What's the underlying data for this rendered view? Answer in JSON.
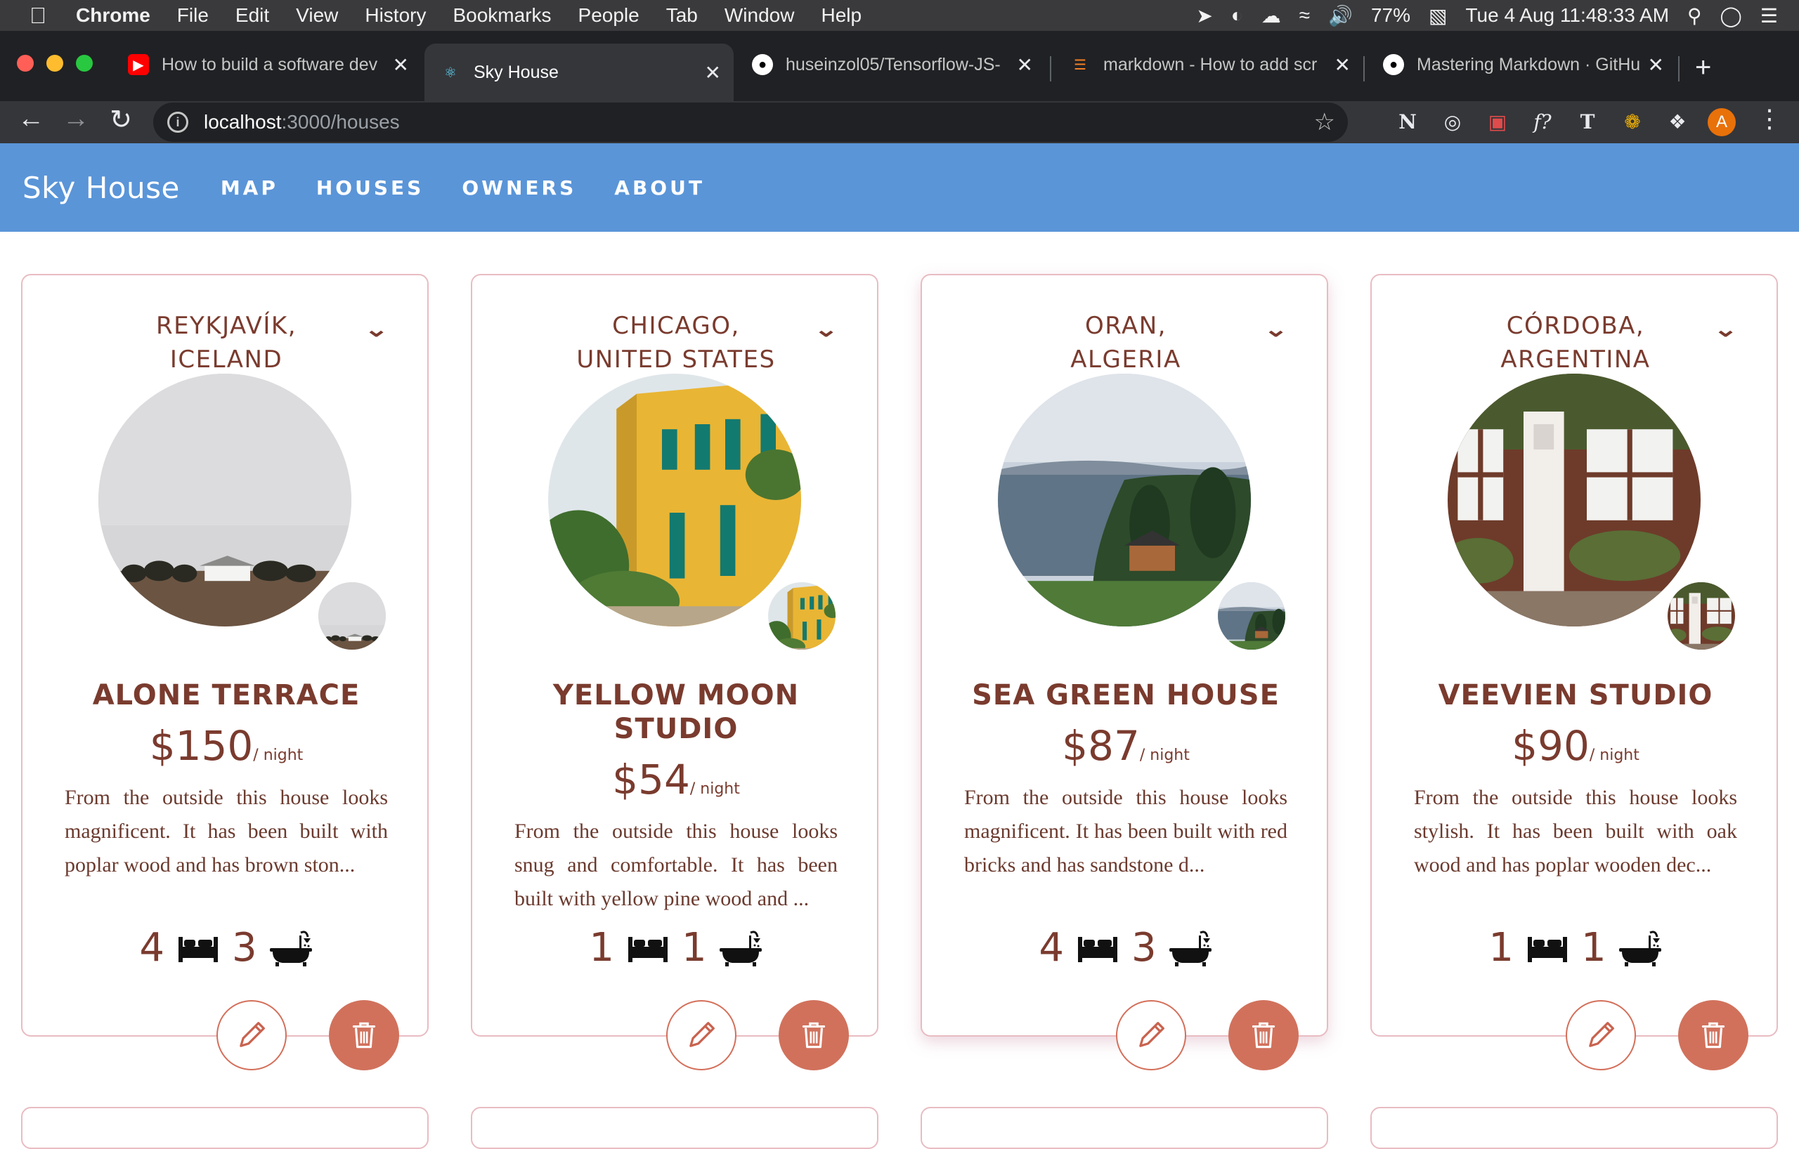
{
  "menubar": {
    "app": "Chrome",
    "items": [
      "File",
      "Edit",
      "View",
      "History",
      "Bookmarks",
      "People",
      "Tab",
      "Window",
      "Help"
    ],
    "battery": "77%",
    "clock": "Tue 4 Aug  11:48:33 AM"
  },
  "tabs": [
    {
      "title": "How to build a software dev",
      "icon": "youtube-icon"
    },
    {
      "title": "Sky House",
      "icon": "react-icon"
    },
    {
      "title": "huseinzol05/Tensorflow-JS-",
      "icon": "github-icon"
    },
    {
      "title": "markdown - How to add scr",
      "icon": "stackoverflow-icon"
    },
    {
      "title": "Mastering Markdown · GitHu",
      "icon": "github-icon"
    }
  ],
  "address": {
    "host": "localhost",
    "path": ":3000/houses"
  },
  "header": {
    "brand": "Sky House",
    "nav": [
      "MAP",
      "HOUSES",
      "OWNERS",
      "ABOUT"
    ]
  },
  "cards": [
    {
      "location_line1": "REYKJAVÍK,",
      "location_line2": "ICELAND",
      "title_line1": "ALONE TERRACE",
      "title_line2": "",
      "price": "$150",
      "per": "/ night",
      "description": "From the outside this house looks magnificent. It has been built with poplar wood and has brown ston...",
      "beds": "4",
      "baths": "3"
    },
    {
      "location_line1": "CHICAGO,",
      "location_line2": "UNITED STATES",
      "title_line1": "YELLOW MOON",
      "title_line2": "STUDIO",
      "price": "$54",
      "per": "/ night",
      "description": "From the outside this house looks snug and comfortable. It has been built with yellow pine wood and ...",
      "beds": "1",
      "baths": "1"
    },
    {
      "location_line1": "ORAN,",
      "location_line2": "ALGERIA",
      "title_line1": "SEA GREEN HOUSE",
      "title_line2": "",
      "price": "$87",
      "per": "/ night",
      "description": "From the outside this house looks magnificent. It has been built with red bricks and has sandstone d...",
      "beds": "4",
      "baths": "3"
    },
    {
      "location_line1": "CÓRDOBA,",
      "location_line2": "ARGENTINA",
      "title_line1": "VEEVIEN STUDIO",
      "title_line2": "",
      "price": "$90",
      "per": "/ night",
      "description": "From the outside this house looks stylish. It has been built with oak wood and has poplar wooden dec...",
      "beds": "1",
      "baths": "1"
    }
  ],
  "colors": {
    "header_bg": "#5a95d8",
    "accent_brown": "#7a3b2e",
    "delete_btn": "#d1715c",
    "card_border": "#e8bcc2"
  }
}
